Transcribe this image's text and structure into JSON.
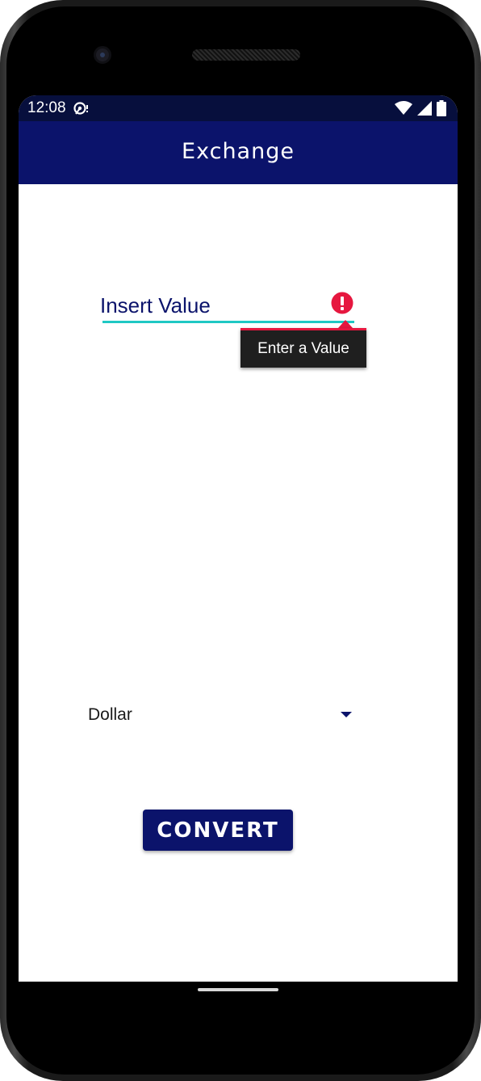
{
  "status_bar": {
    "time": "12:08",
    "icons": [
      "notification-icon",
      "wifi-icon",
      "signal-icon",
      "battery-icon"
    ]
  },
  "app_bar": {
    "title": "Exchange"
  },
  "value_field": {
    "placeholder": "Insert Value",
    "value": "",
    "error_icon": "error-icon",
    "error_message": "Enter a Value"
  },
  "currency_spinner": {
    "selected": "Dollar",
    "icon": "dropdown-arrow-icon"
  },
  "convert_button": {
    "label": "CONVERT"
  },
  "colors": {
    "primary": "#0b136b",
    "status_bar": "#070f3d",
    "accent": "#1fc8c4",
    "error": "#e6173f"
  }
}
